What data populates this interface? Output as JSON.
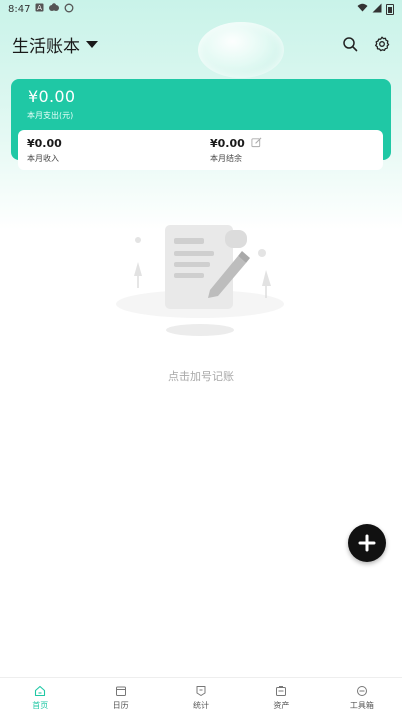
{
  "status_bar": {
    "time": "8:47",
    "icons": [
      "a-icon",
      "notification-icon",
      "circle-icon"
    ],
    "right_icons": [
      "wifi-icon",
      "signal-icon",
      "battery-icon"
    ]
  },
  "header": {
    "book_name": "生活账本",
    "icons": [
      "search-icon",
      "settings-icon"
    ]
  },
  "summary": {
    "total_amount": "¥0.00",
    "total_label": "本月支出(元)",
    "income_amount": "¥0.00",
    "income_label": "本月收入",
    "balance_amount": "¥0.00",
    "balance_label": "本月结余"
  },
  "empty_state": {
    "hint": "点击加号记账"
  },
  "tabs": [
    {
      "label": "首页",
      "icon": "home-icon",
      "active": true
    },
    {
      "label": "日历",
      "icon": "calendar-icon",
      "active": false
    },
    {
      "label": "统计",
      "icon": "stats-icon",
      "active": false
    },
    {
      "label": "资产",
      "icon": "assets-icon",
      "active": false
    },
    {
      "label": "工具箱",
      "icon": "toolbox-icon",
      "active": false
    }
  ],
  "colors": {
    "accent": "#1fc8a5",
    "fab": "#111111"
  }
}
